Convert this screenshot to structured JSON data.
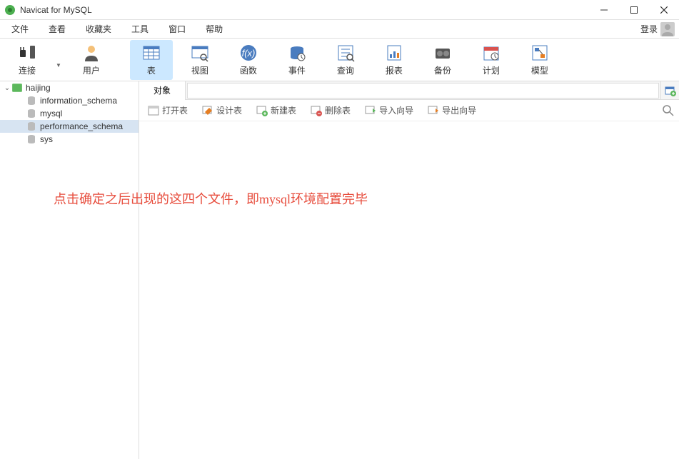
{
  "window": {
    "title": "Navicat for MySQL"
  },
  "menu": {
    "items": [
      "文件",
      "查看",
      "收藏夹",
      "工具",
      "窗口",
      "帮助"
    ],
    "login": "登录"
  },
  "toolbar": {
    "items": [
      {
        "label": "连接",
        "icon": "plug"
      },
      {
        "label": "用户",
        "icon": "user"
      },
      {
        "label": "表",
        "icon": "table",
        "active": true
      },
      {
        "label": "视图",
        "icon": "view"
      },
      {
        "label": "函数",
        "icon": "function"
      },
      {
        "label": "事件",
        "icon": "event"
      },
      {
        "label": "查询",
        "icon": "query"
      },
      {
        "label": "报表",
        "icon": "report"
      },
      {
        "label": "备份",
        "icon": "backup"
      },
      {
        "label": "计划",
        "icon": "schedule"
      },
      {
        "label": "模型",
        "icon": "model"
      }
    ]
  },
  "sidebar": {
    "connection": "haijing",
    "databases": [
      "information_schema",
      "mysql",
      "performance_schema",
      "sys"
    ],
    "selected_index": 2
  },
  "tabs": {
    "active": "对象"
  },
  "actions": {
    "items": [
      "打开表",
      "设计表",
      "新建表",
      "删除表",
      "导入向导",
      "导出向导"
    ]
  },
  "annotation": "点击确定之后出现的这四个文件，即mysql环境配置完毕"
}
